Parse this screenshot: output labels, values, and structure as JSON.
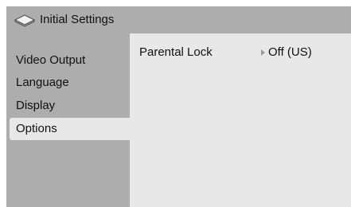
{
  "header": {
    "title": "Initial Settings",
    "icon": "disc-icon"
  },
  "sidebar": {
    "items": [
      {
        "label": "Video Output",
        "active": false
      },
      {
        "label": "Language",
        "active": false
      },
      {
        "label": "Display",
        "active": false
      },
      {
        "label": "Options",
        "active": true
      }
    ]
  },
  "main": {
    "settings": [
      {
        "label": "Parental Lock",
        "value": "Off (US)"
      }
    ]
  },
  "colors": {
    "panel_bg": "#e8e8e8",
    "bar_bg": "#adadad",
    "active_item_bg": "#e8e8e8",
    "arrow": "#9a9a9a"
  }
}
